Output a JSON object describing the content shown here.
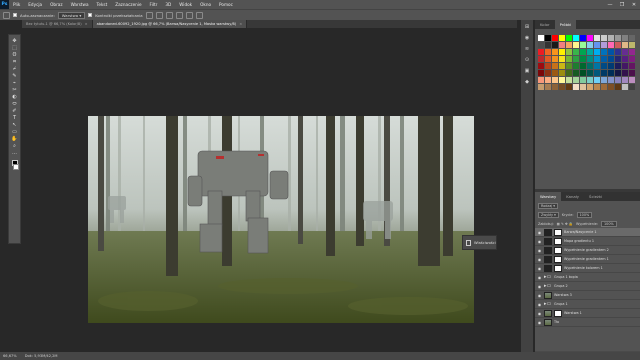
{
  "app": {
    "logo": "Ps"
  },
  "menu": [
    "Plik",
    "Edycja",
    "Obraz",
    "Warstwa",
    "Tekst",
    "Zaznaczenie",
    "Filtr",
    "3D",
    "Widok",
    "Okno",
    "Pomoc"
  ],
  "window_controls": [
    "—",
    "❐",
    "✕"
  ],
  "options": {
    "auto_select_label": "Auto-zaznaczanie:",
    "auto_select_value": "Warstwa",
    "transform_label": "Kontrolki przekształcania"
  },
  "tabs": [
    {
      "title": "Bez tytułu-1 @ 66,7% (Kolor/8)",
      "active": false
    },
    {
      "title": "abandoned-60092_1920.jpg @ 66,7% (Barwa/Nasycenie 1, Maska warstwy/8)",
      "active": true
    }
  ],
  "tools": [
    "✥",
    "⬚",
    "ʘ",
    "⌗",
    "⌿",
    "✎",
    "⌁",
    "✂",
    "◐",
    "⬭",
    "✐",
    "T",
    "↖",
    "▭",
    "✋",
    "⌕",
    "…"
  ],
  "properties_panel": {
    "label": "Właściwości"
  },
  "status": {
    "zoom": "66,67%",
    "doc": "Dok: 5,93M/42,2M"
  },
  "right_icons": [
    "⊞",
    "◉",
    "≋",
    "⊙",
    "▣",
    "◆"
  ],
  "swatch_tabs": [
    {
      "label": "Kolor",
      "active": false
    },
    {
      "label": "Próbki",
      "active": true
    }
  ],
  "swatch_colors": [
    [
      "#ffffff",
      "#000000",
      "#ff0000",
      "#ffff00",
      "#00ff00",
      "#00ffff",
      "#0000ff",
      "#ff00ff",
      "#e6e6e6",
      "#cccccc",
      "#b3b3b3",
      "#999999",
      "#808080",
      "#666666"
    ],
    [
      "#4d4d4d",
      "#333333",
      "#1a1a1a",
      "#f08080",
      "#f4a460",
      "#fff68f",
      "#98fb98",
      "#87ceeb",
      "#6495ed",
      "#b19cd9",
      "#ff69b4",
      "#cd5c5c",
      "#deb887",
      "#bdb76b"
    ],
    [
      "#ed1c24",
      "#f26522",
      "#f7941d",
      "#fff200",
      "#8dc63f",
      "#39b54a",
      "#00a651",
      "#00a99d",
      "#00aeef",
      "#0072bc",
      "#0054a6",
      "#2e3192",
      "#662d91",
      "#92278f"
    ],
    [
      "#c1272d",
      "#e25b24",
      "#f09120",
      "#f5e41e",
      "#77b833",
      "#2ea043",
      "#008c44",
      "#008f84",
      "#0093cc",
      "#005ea8",
      "#004a92",
      "#262772",
      "#561f80",
      "#7f1e7e"
    ],
    [
      "#9e0b0f",
      "#b8441b",
      "#c7721a",
      "#c9b816",
      "#5a8f25",
      "#1f7d30",
      "#00682f",
      "#006e66",
      "#0075a4",
      "#004a85",
      "#003b73",
      "#1c1d5a",
      "#431864",
      "#631662"
    ],
    [
      "#7a0709",
      "#8c3214",
      "#9c5913",
      "#9b8d10",
      "#42691b",
      "#165b23",
      "#004f24",
      "#00534d",
      "#00597c",
      "#003a66",
      "#002d57",
      "#151644",
      "#33124c",
      "#4b104b"
    ],
    [
      "#f7977a",
      "#fbad82",
      "#fdc68c",
      "#fff799",
      "#c4df9b",
      "#a3d39c",
      "#82ca9d",
      "#7bcdc8",
      "#6ecff6",
      "#7ea7d8",
      "#8493ca",
      "#8882be",
      "#a187be",
      "#bc8dbf"
    ],
    [
      "#c69c6e",
      "#a67c52",
      "#8c6239",
      "#754c24",
      "#603913",
      "#f2e0c9",
      "#e0c39e",
      "#d1a570",
      "#b8864f",
      "#9c6a39",
      "#7d4f26",
      "#5e3815",
      "#c0c0c0",
      "#404040"
    ]
  ],
  "layer_tabs": [
    {
      "label": "Warstwy",
      "active": true
    },
    {
      "label": "Kanały",
      "active": false
    },
    {
      "label": "Ścieżki",
      "active": false
    }
  ],
  "layer_controls": {
    "kind": "Rodzaj",
    "mode": "Zwykły",
    "opacity_label": "Krycie:",
    "opacity_value": "100%",
    "lock_label": "Zablokuj:",
    "fill_label": "Wypełnienie:",
    "fill_value": "100%"
  },
  "layers": [
    {
      "name": "Barwa/Nasycenie 1",
      "thumb": "dark",
      "mask": true,
      "selected": true
    },
    {
      "name": "Mapa gradientu 1",
      "thumb": "dark",
      "mask": true,
      "selected": false
    },
    {
      "name": "Wypełnienie gradientem 2",
      "thumb": "dark",
      "mask": true,
      "selected": false
    },
    {
      "name": "Wypełnienie gradientem 1",
      "thumb": "dark",
      "mask": true,
      "selected": false
    },
    {
      "name": "Wypełnienie kolorem 1",
      "thumb": "dark",
      "mask": true,
      "selected": false
    },
    {
      "name": "Grupa 1 kopia",
      "thumb": "folder",
      "mask": false,
      "selected": false
    },
    {
      "name": "Grupa 2",
      "thumb": "folder",
      "mask": false,
      "selected": false
    },
    {
      "name": "Warstwa 3",
      "thumb": "img",
      "mask": false,
      "selected": false
    },
    {
      "name": "Grupa 1",
      "thumb": "folder",
      "mask": false,
      "selected": false
    },
    {
      "name": "Warstwa 1",
      "thumb": "img",
      "mask": true,
      "selected": false
    },
    {
      "name": "Tło",
      "thumb": "img",
      "mask": false,
      "selected": false
    }
  ],
  "layer_bottom_icons": [
    "⛓",
    "fx",
    "◙",
    "◐",
    "▭",
    "⊕",
    "🗑"
  ]
}
